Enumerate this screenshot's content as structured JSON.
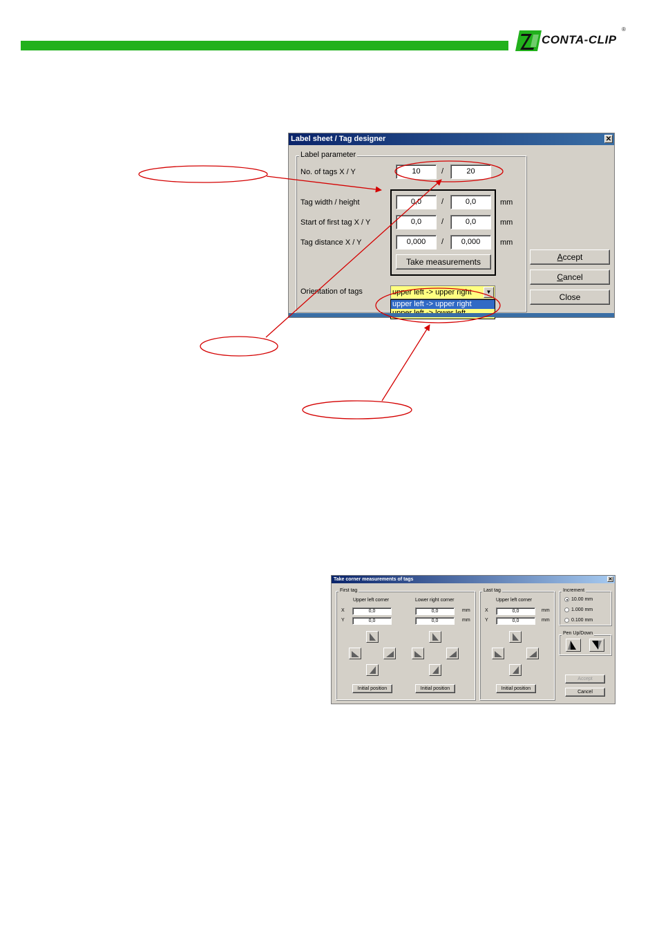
{
  "header": {
    "logo_text": "CONTA-CLIP",
    "logo_mark": "®",
    "bar_color": "#22b11c"
  },
  "label_dialog": {
    "title": "Label sheet / Tag designer",
    "close_glyph": "✕",
    "group_label": "Label parameter",
    "rows": {
      "tags_label": "No. of tags X / Y",
      "tags_x": "10",
      "tags_y": "20",
      "width_label": "Tag width / height",
      "width": "0,0",
      "height": "0,0",
      "start_label": "Start of first tag X / Y",
      "start_x": "0,0",
      "start_y": "0,0",
      "distance_label": "Tag distance  X / Y",
      "distance_x": "0,000",
      "distance_y": "0,000",
      "slash": "/",
      "unit": "mm"
    },
    "take_measurements": "Take measurements",
    "orientation_label": "Orientation of tags",
    "orientation_selected": "upper left -> upper right",
    "orientation_options": [
      "upper left -> upper right",
      "upper left -> lower left"
    ],
    "accept": "Accept",
    "cancel": "Cancel",
    "close": "Close"
  },
  "corner_dialog": {
    "title": "Take corner measurements of tags",
    "close_glyph": "✕",
    "first_tag": {
      "group_label": "First tag",
      "upper_left_label": "Upper left corner",
      "lower_right_label": "Lower right corner",
      "x_label": "X",
      "y_label": "Y",
      "ul_x": "0,0",
      "ul_y": "0,0",
      "lr_x": "0,0",
      "lr_y": "0,0",
      "unit": "mm",
      "initial_position": "Initial position"
    },
    "last_tag": {
      "group_label": "Last tag",
      "upper_left_label": "Upper left corner",
      "x_label": "X",
      "y_label": "Y",
      "ul_x": "0,0",
      "ul_y": "0,0",
      "unit": "mm",
      "initial_position": "Initial position"
    },
    "increment": {
      "group_label": "Increment",
      "options": [
        "10.00 mm",
        "1.000 mm",
        "0.100 mm"
      ],
      "selected_index": 0
    },
    "pen": {
      "group_label": "Pen Up/Down"
    },
    "accept": "Accept",
    "cancel": "Cancel"
  },
  "annotation_color": "#d40000"
}
